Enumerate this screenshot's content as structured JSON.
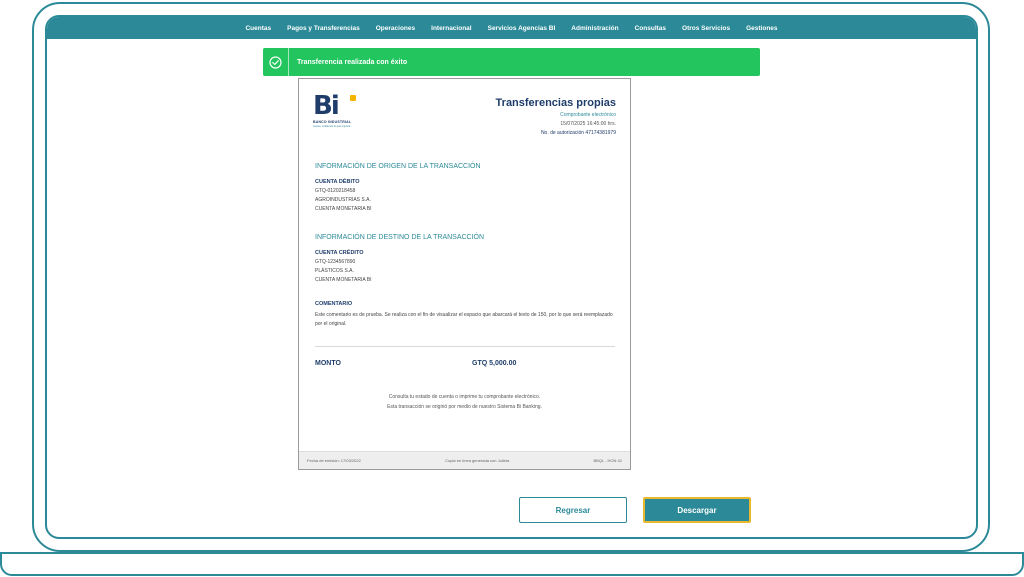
{
  "navbar": {
    "items": [
      "Cuentas",
      "Pagos y Transferencias",
      "Operaciones",
      "Internacional",
      "Servicios Agencias BI",
      "Administración",
      "Consultas",
      "Otros Servicios",
      "Gestiones"
    ]
  },
  "banner": {
    "message": "Transferencia realizada con éxito",
    "color": "#22c55e",
    "icon": "check-circle-icon"
  },
  "receipt": {
    "logo": {
      "mark": "Bi",
      "bank_name": "BANCO INDUSTRIAL",
      "tagline": "Juntos, cuidamos lo que importa"
    },
    "title": "Transferencias propias",
    "subtitle": "Comprobante electrónico",
    "datetime": "15/07/2025 16:45:00 hrs.",
    "authorization": "No. de autorización 47174381979",
    "origin": {
      "section_title": "INFORMACIÓN DE ORIGEN DE LA TRANSACCIÓN",
      "label": "CUENTA DÉBITO",
      "account": "GTQ-0120218458",
      "holder": "AGROINDUSTRIAS S.A.",
      "type": "CUENTA MONETARIA BI"
    },
    "destination": {
      "section_title": "INFORMACIÓN DE DESTINO DE LA TRANSACCIÓN",
      "label": "CUENTA CRÉDITO",
      "account": "GTQ-1234567890",
      "holder": "PLÁSTICOS S.A.",
      "type": "CUENTA MONETARIA BI"
    },
    "comment": {
      "label": "COMENTARIO",
      "text": "Este comentario es de prueba. Se realiza con el fin de visualizar el espacio que abarcará el texto de 150, por lo que será reemplazado por el original."
    },
    "amount": {
      "label": "MONTO",
      "value": "GTQ 5,000.00"
    },
    "footnote": {
      "line1": "Consulta tu estado de cuenta o imprime tu comprobante electrónico.",
      "line2": "Esta transacción se originó por medio de nuestro Sistema Bi Banking."
    },
    "footer": {
      "issued": "Fecha de emisión: 17/03/2022",
      "generated": "Copia en línea generada con Julieta",
      "code": "BBQL - HON 42"
    }
  },
  "buttons": {
    "back": "Regresar",
    "download": "Descargar"
  },
  "colors": {
    "brand_teal": "#2c8a98",
    "brand_navy": "#1f3d6b",
    "brand_yellow": "#f4b400",
    "focus_outline": "#e8b92e"
  }
}
